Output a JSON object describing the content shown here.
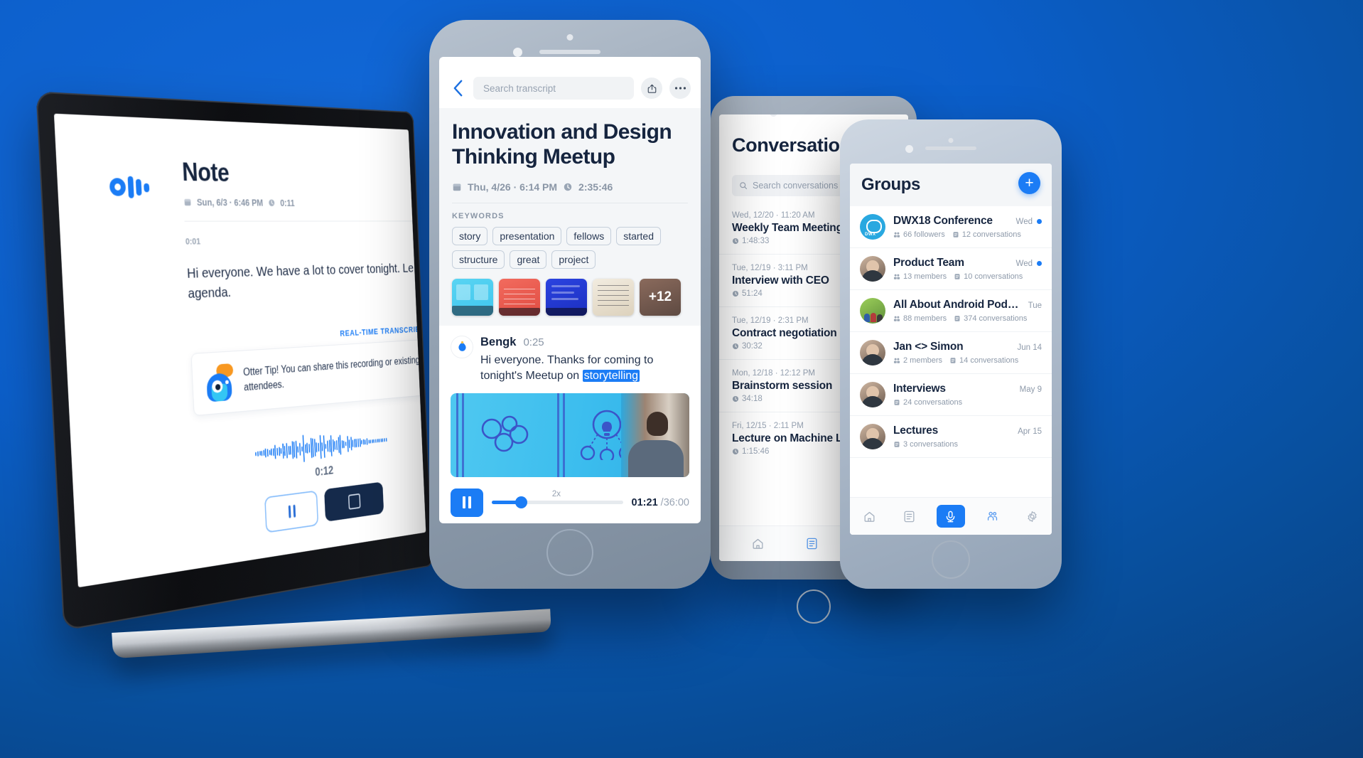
{
  "brand": {
    "name": "Otter",
    "accent": "#1b7cf5",
    "dark": "#16253f"
  },
  "laptop": {
    "logo_name": "otter-logo",
    "note_title": "Note",
    "note_date": "Sun, 6/3 · 6:46 PM",
    "note_duration": "0:11",
    "segment_time": "0:01",
    "segment_text": "Hi everyone. We have a lot to cover tonight. Le the agenda.",
    "status_label": "REAL-TIME TRANSCRIBING",
    "tip_text": "Otter Tip! You can share this recording or existing attendees.",
    "wave_time": "0:12",
    "pause_label": "pause",
    "stop_label": "stop"
  },
  "tablet": {
    "title": "Conversations",
    "search_placeholder": "Search conversations",
    "conversations": [
      {
        "date": "Wed, 12/20 · 11:20 AM",
        "name": "Weekly Team Meeting",
        "duration": "1:48:33"
      },
      {
        "date": "Tue, 12/19 · 3:11 PM",
        "name": "Interview with CEO",
        "duration": "51:24"
      },
      {
        "date": "Tue, 12/19 · 2:31 PM",
        "name": "Contract negotiation call",
        "duration": "30:32"
      },
      {
        "date": "Mon, 12/18 · 12:12 PM",
        "name": "Brainstorm session",
        "duration": "34:18"
      },
      {
        "date": "Fri, 12/15 · 2:11 PM",
        "name": "Lecture on Machine Learning",
        "duration": "1:15:46"
      }
    ],
    "nav": [
      {
        "icon": "home-icon",
        "active": false
      },
      {
        "icon": "notes-icon",
        "active": false
      },
      {
        "icon": "record-icon",
        "active": true
      }
    ]
  },
  "phone_right": {
    "title": "Groups",
    "add_label": "+",
    "groups": [
      {
        "name": "DWX18 Conference",
        "when": "Wed",
        "unread": true,
        "stat1": "66 followers",
        "stat2": "12 conversations",
        "avatar": "dwx-logo-avatar"
      },
      {
        "name": "Product Team",
        "when": "Wed",
        "unread": true,
        "stat1": "13 members",
        "stat2": "10 conversations",
        "avatar": "person-avatar"
      },
      {
        "name": "All About Android Podcast",
        "when": "Tue",
        "unread": false,
        "stat1": "88 members",
        "stat2": "374 conversations",
        "avatar": "android-podcast-avatar"
      },
      {
        "name": "Jan <> Simon",
        "when": "Jun 14",
        "unread": false,
        "stat1": "2 members",
        "stat2": "14 conversations",
        "avatar": "person-avatar"
      },
      {
        "name": "Interviews",
        "when": "May 9",
        "unread": false,
        "stat1": "",
        "stat2": "24 conversations",
        "avatar": "person-avatar"
      },
      {
        "name": "Lectures",
        "when": "Apr 15",
        "unread": false,
        "stat1": "",
        "stat2": "3 conversations",
        "avatar": "person-avatar"
      }
    ],
    "nav": [
      {
        "icon": "home-icon",
        "active": false
      },
      {
        "icon": "notes-icon",
        "active": false
      },
      {
        "icon": "record-icon",
        "active": true
      },
      {
        "icon": "people-icon",
        "active": false
      },
      {
        "icon": "gear-icon",
        "active": false
      }
    ]
  },
  "phone_center": {
    "search_placeholder": "Search transcript",
    "back_label": "back",
    "share_label": "share",
    "more_label": "more",
    "title": "Innovation and Design Thinking Meetup",
    "date": "Thu, 4/26 · 6:14 PM",
    "duration": "2:35:46",
    "keywords_label": "KEYWORDS",
    "keywords": [
      "story",
      "presentation",
      "fellows",
      "started",
      "structure",
      "great",
      "project"
    ],
    "thumbs_overflow": "+12",
    "transcript": {
      "speaker": "Bengk",
      "time": "0:25",
      "text_before": "Hi everyone. Thanks for coming to tonight's Meetup on ",
      "highlight": "storytelling"
    },
    "player": {
      "state": "playing",
      "speed": "2x",
      "current_time": "01:21",
      "total_time": "/36:00"
    }
  }
}
